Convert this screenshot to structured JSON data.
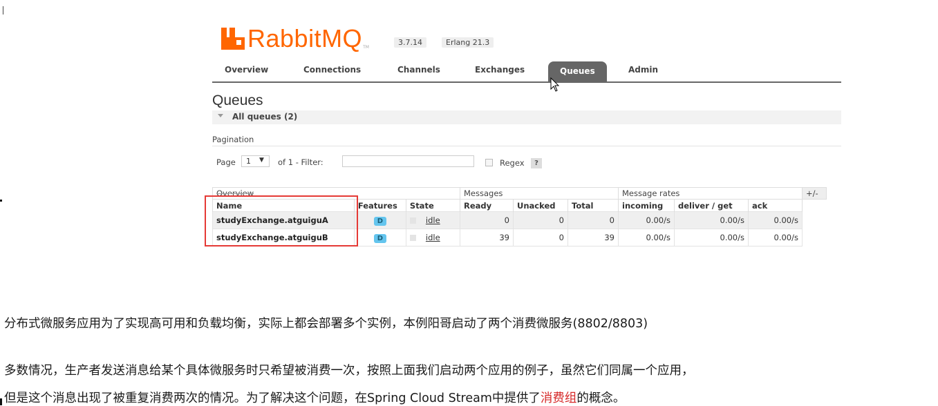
{
  "app": {
    "logo_text": "RabbitMQ",
    "logo_tm": "TM",
    "version": "3.7.14",
    "erlang": "Erlang 21.3",
    "brand_color": "#ff6600"
  },
  "nav": {
    "tabs": [
      {
        "label": "Overview"
      },
      {
        "label": "Connections"
      },
      {
        "label": "Channels"
      },
      {
        "label": "Exchanges"
      },
      {
        "label": "Queues",
        "active": true
      },
      {
        "label": "Admin"
      }
    ]
  },
  "page": {
    "title": "Queues",
    "section": "All queues (2)",
    "pagination_label": "Pagination",
    "page_word": "Page",
    "page_value": "1",
    "page_options_icon": "chevron-down-icon",
    "of_text": "of 1  - Filter:",
    "filter_value": "",
    "regex_label": "Regex",
    "help_label": "?"
  },
  "table": {
    "groups": [
      "Overview",
      "Messages",
      "Message rates"
    ],
    "toggle_label": "+/-",
    "columns": [
      "Name",
      "Features",
      "State",
      "Ready",
      "Unacked",
      "Total",
      "incoming",
      "deliver / get",
      "ack"
    ],
    "rows": [
      {
        "name": "studyExchange.atguiguA",
        "feature": "D",
        "state": "idle",
        "ready": "0",
        "unacked": "0",
        "total": "0",
        "incoming": "0.00/s",
        "deliver_get": "0.00/s",
        "ack": "0.00/s"
      },
      {
        "name": "studyExchange.atguiguB",
        "feature": "D",
        "state": "idle",
        "ready": "39",
        "unacked": "0",
        "total": "39",
        "incoming": "0.00/s",
        "deliver_get": "0.00/s",
        "ack": "0.00/s"
      }
    ]
  },
  "doc": {
    "para1": "分布式微服务应用为了实现高可用和负载均衡，实际上都会部署多个实例，本例阳哥启动了两个消费微服务(8802/8803)",
    "para2": "多数情况，生产者发送消息给某个具体微服务时只希望被消费一次，按照上面我们启动两个应用的例子，虽然它们同属一个应用，",
    "para3_pre": "但是这个消息出现了被重复消费两次的情况。为了解决这个问题，在Spring Cloud Stream中提供了",
    "para3_highlight": "消费组",
    "para3_post": "的概念。",
    "highlight_color": "#d62828"
  }
}
